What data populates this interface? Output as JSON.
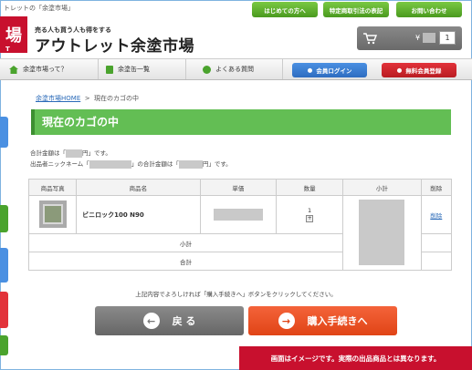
{
  "header": {
    "top_text": "トレットの「余塗市場」",
    "btn_first": "はじめての方へ",
    "btn_law": "特定商取引法の表記",
    "btn_contact": "お問い合わせ",
    "logo_glyph": "場",
    "logo_sub_glyph": "T",
    "tagline": "売る人も買う人も得をする",
    "site_name": "アウトレット余塗市場",
    "cart_yen": "¥",
    "cart_count": "1",
    "accent": "#c8102e"
  },
  "nav": {
    "about": "余塗市場って？",
    "cans": "余塗缶一覧",
    "faq": "よくある質問",
    "login": "会員ログイン",
    "register": "無料会員登録"
  },
  "breadcrumb": {
    "home": "余塗市場HOME",
    "sep": ">",
    "current": "現在のカゴの中"
  },
  "page_title": "現在のカゴの中",
  "info": {
    "line1_a": "合計金額は「",
    "line1_b": "円」です。",
    "line2_a": "出品者ニックネーム「",
    "line2_b": "」の合計金額は「",
    "line2_c": "円」です。"
  },
  "table": {
    "headers": [
      "商品写真",
      "商品名",
      "単価",
      "数量",
      "小計",
      "削除"
    ],
    "item_name": "ビニロック100 N90",
    "qty": "1",
    "qty_plus": "+",
    "delete": "削除",
    "subtotal_label": "小計",
    "total_label": "合計"
  },
  "instruction": "上記内容でよろしければ「購入手続きへ」ボタンをクリックしてください。",
  "buttons": {
    "back": "戻 る",
    "back_icon": "←",
    "next": "購入手続きへ",
    "next_icon": "→"
  },
  "notice": "画面はイメージです。実際の出品商品とは異なります。"
}
